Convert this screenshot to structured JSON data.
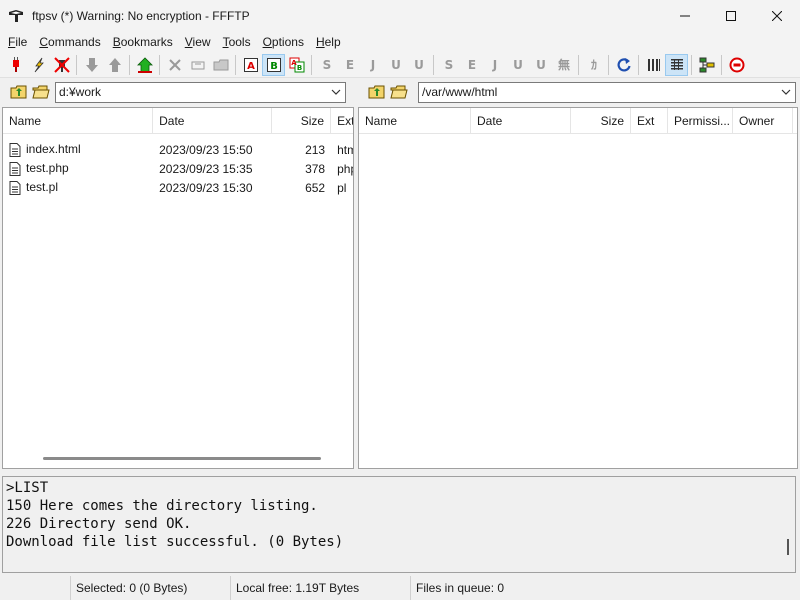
{
  "window": {
    "title": "ftpsv (*) Warning: No encryption - FFFTP"
  },
  "menu": [
    {
      "key": "F",
      "rest": "ile"
    },
    {
      "key": "C",
      "rest": "ommands"
    },
    {
      "key": "B",
      "rest": "ookmarks"
    },
    {
      "key": "V",
      "rest": "iew"
    },
    {
      "key": "T",
      "rest": "ools"
    },
    {
      "key": "O",
      "rest": "ptions"
    },
    {
      "key": "H",
      "rest": "elp"
    }
  ],
  "toolbar": {
    "text_buttons": [
      "S",
      "E",
      "J",
      "U",
      "U",
      "S",
      "E",
      "J",
      "U",
      "U",
      "無",
      "ｶ"
    ]
  },
  "local": {
    "path": "d:¥work",
    "columns": [
      "Name",
      "Date",
      "Size",
      "Ext"
    ],
    "files": [
      {
        "name": "index.html",
        "date": "2023/09/23 15:50",
        "size": "213",
        "ext": "html"
      },
      {
        "name": "test.php",
        "date": "2023/09/23 15:35",
        "size": "378",
        "ext": "php"
      },
      {
        "name": "test.pl",
        "date": "2023/09/23 15:30",
        "size": "652",
        "ext": "pl"
      }
    ]
  },
  "remote": {
    "path": "/var/www/html",
    "columns": [
      "Name",
      "Date",
      "Size",
      "Ext",
      "Permissi...",
      "Owner"
    ],
    "files": []
  },
  "log": {
    "lines": [
      ">LIST",
      "150 Here comes the directory listing.",
      "226 Directory send OK.",
      "Download file list successful. (0 Bytes)"
    ]
  },
  "status": {
    "selected": "Selected: 0 (0 Bytes)",
    "local_free": "Local free: 1.19T Bytes",
    "queue": "Files in queue: 0"
  }
}
